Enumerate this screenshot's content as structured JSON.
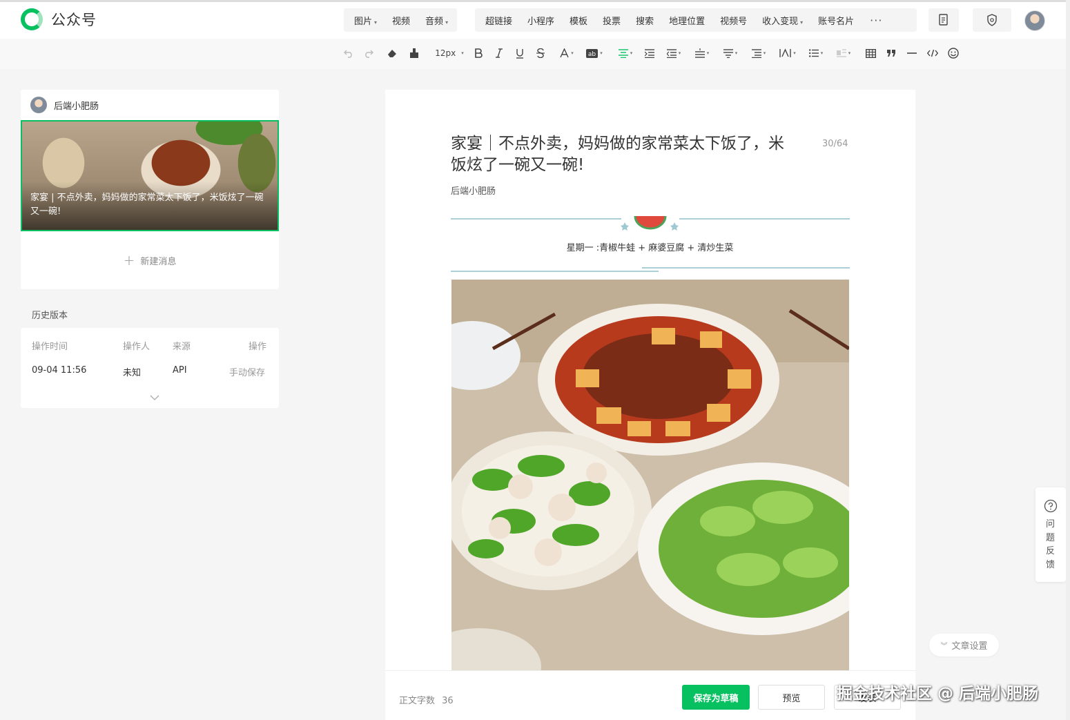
{
  "app": {
    "name": "公众号"
  },
  "topbar": {
    "insert_menu": [
      {
        "label": "图片",
        "has_dropdown": true
      },
      {
        "label": "视频",
        "has_dropdown": false
      },
      {
        "label": "音频",
        "has_dropdown": true
      }
    ],
    "feature_menu": [
      {
        "label": "超链接",
        "has_dropdown": false
      },
      {
        "label": "小程序",
        "has_dropdown": false
      },
      {
        "label": "模板",
        "has_dropdown": false
      },
      {
        "label": "投票",
        "has_dropdown": false
      },
      {
        "label": "搜索",
        "has_dropdown": false
      },
      {
        "label": "地理位置",
        "has_dropdown": false
      },
      {
        "label": "视频号",
        "has_dropdown": false
      },
      {
        "label": "收入变现",
        "has_dropdown": true
      },
      {
        "label": "账号名片",
        "has_dropdown": false
      }
    ],
    "more_label": "···"
  },
  "toolbar": {
    "font_size": "12px"
  },
  "draft": {
    "author": "后端小肥肠",
    "cover_title": "家宴 | 不点外卖，妈妈做的家常菜太下饭了，米饭炫了一碗又一碗!",
    "new_message_label": "新建消息"
  },
  "history": {
    "title": "历史版本",
    "headers": {
      "time": "操作时间",
      "operator": "操作人",
      "source": "来源",
      "action": "操作"
    },
    "rows": [
      {
        "time": "09-04 11:56",
        "operator": "未知",
        "source": "API",
        "action": "手动保存"
      }
    ]
  },
  "article": {
    "title": "家宴｜不点外卖，妈妈做的家常菜太下饭了，米饭炫了一碗又一碗!",
    "title_count": "30/64",
    "author": "后端小肥肠",
    "day_line": "星期一 :青椒牛蛙 + 麻婆豆腐 + 清炒生菜"
  },
  "footer": {
    "wordcount_label": "正文字数",
    "wordcount": "36",
    "save_draft": "保存为草稿",
    "preview": "预览",
    "publish": "发表"
  },
  "side": {
    "feedback": "问题反馈",
    "settings": "文章设置"
  },
  "watermark": "掘金技术社区 @ 后端小肥肠",
  "colors": {
    "brand": "#07c160",
    "divider": "#8dbfc9"
  }
}
